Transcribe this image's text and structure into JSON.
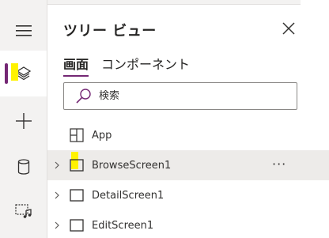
{
  "colors": {
    "accent": "#742774",
    "highlight": "#fff200",
    "rail_bg": "#f3f2f1",
    "selected_row_bg": "#edebe9"
  },
  "rail": {
    "items": [
      {
        "name": "hamburger-menu-icon",
        "active": false
      },
      {
        "name": "layers-icon",
        "active": true
      },
      {
        "name": "plus-icon",
        "active": false
      },
      {
        "name": "database-icon",
        "active": false
      },
      {
        "name": "media-icon",
        "active": false
      }
    ]
  },
  "panel": {
    "title": "ツリー ビュー",
    "tabs": [
      {
        "label": "画面",
        "selected": true
      },
      {
        "label": "コンポーネント",
        "selected": false
      }
    ],
    "search": {
      "placeholder": "検索",
      "value": ""
    },
    "tree": [
      {
        "label": "App",
        "icon": "app-grid-icon",
        "expandable": false,
        "selected": false
      },
      {
        "label": "BrowseScreen1",
        "icon": "screen-icon",
        "expandable": true,
        "selected": true,
        "more": "···"
      },
      {
        "label": "DetailScreen1",
        "icon": "screen-icon",
        "expandable": true,
        "selected": false
      },
      {
        "label": "EditScreen1",
        "icon": "screen-icon",
        "expandable": true,
        "selected": false
      }
    ]
  }
}
